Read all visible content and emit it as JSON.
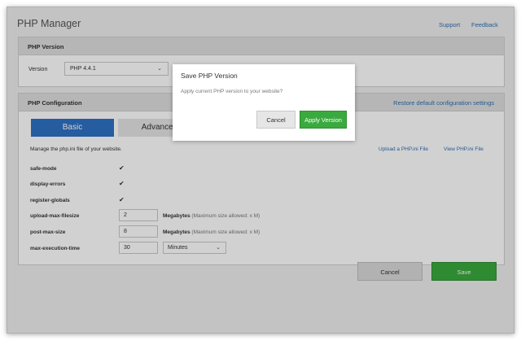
{
  "app": {
    "title": "PHP Manager"
  },
  "top_links": {
    "support": "Support",
    "feedback": "Feedback"
  },
  "version_panel": {
    "header": "PHP Version",
    "label": "Version",
    "selected": "PHP 4.4.1",
    "icon": "chevron-down-icon"
  },
  "config_panel": {
    "header": "PHP Configuration",
    "restore_link": "Restore default configuration settings",
    "tabs": [
      {
        "label": "Basic",
        "active": true
      },
      {
        "label": "Advanced",
        "active": false
      }
    ],
    "description": "Manage the php.ini file of your website.",
    "upload_link": "Upload a PHP.ini File",
    "view_link": "View PHP.ini File",
    "check_glyph": "✔",
    "settings": [
      {
        "name": "safe-mode",
        "checked": true
      },
      {
        "name": "display-errors",
        "checked": true
      },
      {
        "name": "register-globals",
        "checked": true
      },
      {
        "name": "upload-max-filesize",
        "value": "2",
        "unit": "Megabytes",
        "hint": "(Maximum size allowed: x M)"
      },
      {
        "name": "post-max-size",
        "value": "8",
        "unit": "Megabytes",
        "hint": "(Maximum size allowed: x M)"
      },
      {
        "name": "max-execution-time",
        "value": "30",
        "unit_select": "Minutes"
      }
    ]
  },
  "footer": {
    "cancel": "Cancel",
    "save": "Save"
  },
  "modal": {
    "title": "Save PHP Version",
    "message": "Apply current PHP version to your website?",
    "cancel": "Cancel",
    "apply": "Apply Version"
  },
  "colors": {
    "primary": "#2f71c4",
    "success": "#3aaa3e",
    "link": "#2f6fb2"
  }
}
